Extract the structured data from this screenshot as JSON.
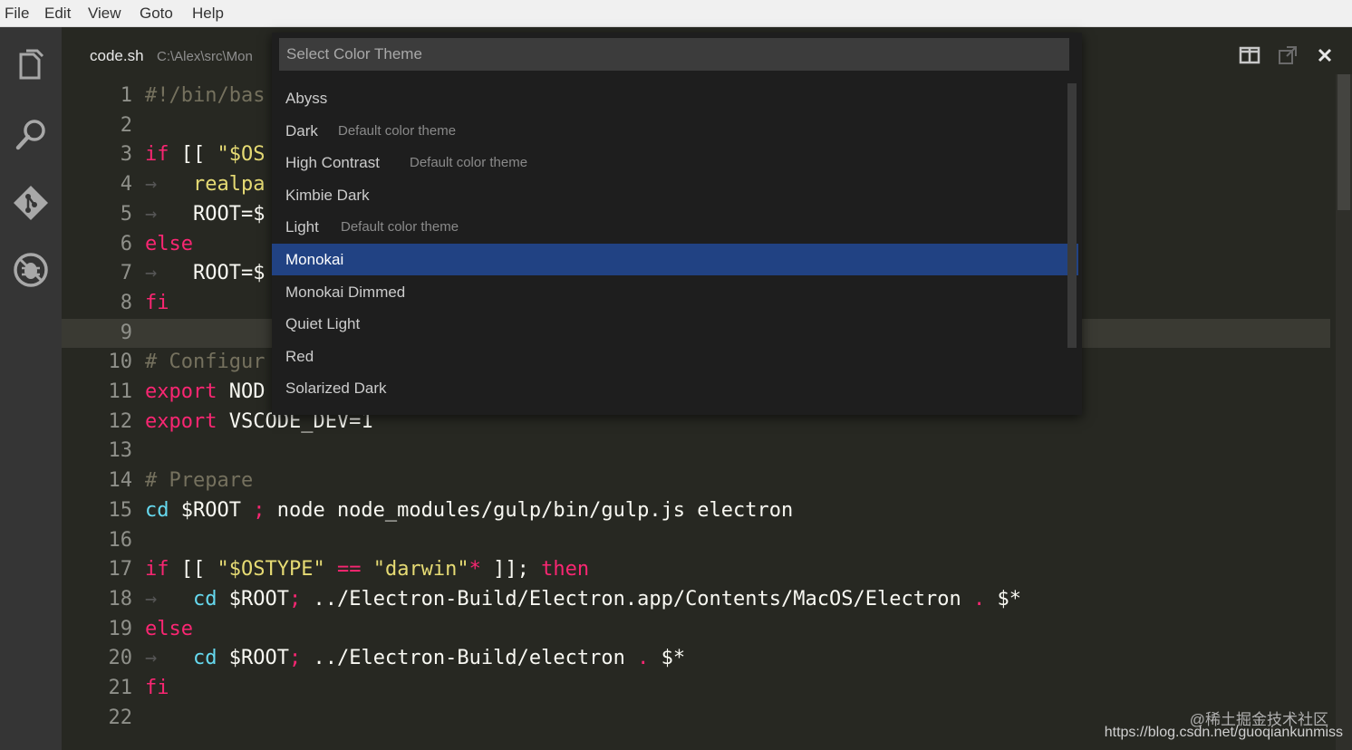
{
  "menu": [
    "File",
    "Edit",
    "View",
    "Goto",
    "Help"
  ],
  "activity_bar": {
    "icons": [
      "files-icon",
      "search-icon",
      "git-icon",
      "debug-icon"
    ]
  },
  "editor": {
    "tab": {
      "file_name": "code.sh",
      "path": "C:\\Alex\\src\\Mon"
    },
    "actions": [
      "split-editor-icon",
      "open-side-icon",
      "close-icon"
    ],
    "lines": [
      {
        "n": "1",
        "segs": [
          [
            "cm",
            "#!/bin/bas"
          ]
        ]
      },
      {
        "n": "2",
        "segs": []
      },
      {
        "n": "3",
        "segs": [
          [
            "kw",
            "if"
          ],
          [
            "wh",
            " [[ "
          ],
          [
            "st",
            "\"$OS"
          ]
        ]
      },
      {
        "n": "4",
        "segs": [
          [
            "ind",
            "→   "
          ],
          [
            "st",
            "realpa"
          ]
        ]
      },
      {
        "n": "5",
        "segs": [
          [
            "ind",
            "→   "
          ],
          [
            "wh",
            "ROOT=$"
          ]
        ]
      },
      {
        "n": "6",
        "segs": [
          [
            "kw",
            "else"
          ]
        ]
      },
      {
        "n": "7",
        "segs": [
          [
            "ind",
            "→   "
          ],
          [
            "wh",
            "ROOT=$"
          ]
        ]
      },
      {
        "n": "8",
        "segs": [
          [
            "kw",
            "fi"
          ]
        ]
      },
      {
        "n": "9",
        "segs": []
      },
      {
        "n": "10",
        "segs": [
          [
            "cm",
            "# Configur"
          ]
        ]
      },
      {
        "n": "11",
        "segs": [
          [
            "kw",
            "export"
          ],
          [
            "wh",
            " NOD"
          ]
        ]
      },
      {
        "n": "12",
        "segs": [
          [
            "kw",
            "export"
          ],
          [
            "wh",
            " VSCODE_DEV=1"
          ]
        ]
      },
      {
        "n": "13",
        "segs": []
      },
      {
        "n": "14",
        "segs": [
          [
            "cm",
            "# Prepare"
          ]
        ]
      },
      {
        "n": "15",
        "segs": [
          [
            "bl",
            "cd"
          ],
          [
            "wh",
            " $ROOT "
          ],
          [
            "kw",
            ";"
          ],
          [
            "wh",
            " node node_modules/gulp/bin/gulp.js electron"
          ]
        ]
      },
      {
        "n": "16",
        "segs": []
      },
      {
        "n": "17",
        "segs": [
          [
            "kw",
            "if"
          ],
          [
            "wh",
            " [[ "
          ],
          [
            "st",
            "\"$OSTYPE\""
          ],
          [
            "wh",
            " "
          ],
          [
            "kw",
            "=="
          ],
          [
            "wh",
            " "
          ],
          [
            "st",
            "\"darwin\""
          ],
          [
            "kw",
            "*"
          ],
          [
            "wh",
            " ]]; "
          ],
          [
            "kw",
            "then"
          ]
        ]
      },
      {
        "n": "18",
        "segs": [
          [
            "ind",
            "→   "
          ],
          [
            "bl",
            "cd"
          ],
          [
            "wh",
            " $ROOT"
          ],
          [
            "kw",
            ";"
          ],
          [
            "wh",
            " ../Electron-Build/Electron.app/Contents/MacOS/Electron "
          ],
          [
            "kw",
            "."
          ],
          [
            "wh",
            " $*"
          ]
        ]
      },
      {
        "n": "19",
        "segs": [
          [
            "kw",
            "else"
          ]
        ]
      },
      {
        "n": "20",
        "segs": [
          [
            "ind",
            "→   "
          ],
          [
            "bl",
            "cd"
          ],
          [
            "wh",
            " $ROOT"
          ],
          [
            "kw",
            ";"
          ],
          [
            "wh",
            " ../Electron-Build/electron "
          ],
          [
            "kw",
            "."
          ],
          [
            "wh",
            " $*"
          ]
        ]
      },
      {
        "n": "21",
        "segs": [
          [
            "kw",
            "fi"
          ]
        ]
      },
      {
        "n": "22",
        "segs": []
      }
    ],
    "current_line": "9"
  },
  "quick_pick": {
    "placeholder": "Select Color Theme",
    "selected": "Monokai",
    "items": [
      {
        "label": "Abyss",
        "description": ""
      },
      {
        "label": "Dark",
        "description": "Default color theme"
      },
      {
        "label": "High Contrast",
        "description": "Default color theme"
      },
      {
        "label": "Kimbie Dark",
        "description": ""
      },
      {
        "label": "Light",
        "description": "Default color theme"
      },
      {
        "label": "Monokai",
        "description": ""
      },
      {
        "label": "Monokai Dimmed",
        "description": ""
      },
      {
        "label": "Quiet Light",
        "description": ""
      },
      {
        "label": "Red",
        "description": ""
      },
      {
        "label": "Solarized Dark",
        "description": ""
      }
    ]
  },
  "watermark": {
    "line1": "@稀土掘金技术社区",
    "line2": "https://blog.csdn.net/guoqiankunmiss"
  },
  "colors": {
    "editor_bg": "#272822",
    "keyword": "#f92672",
    "builtin": "#66d9ef",
    "string": "#e6db74",
    "comment": "#75715e",
    "selection": "#214283"
  }
}
